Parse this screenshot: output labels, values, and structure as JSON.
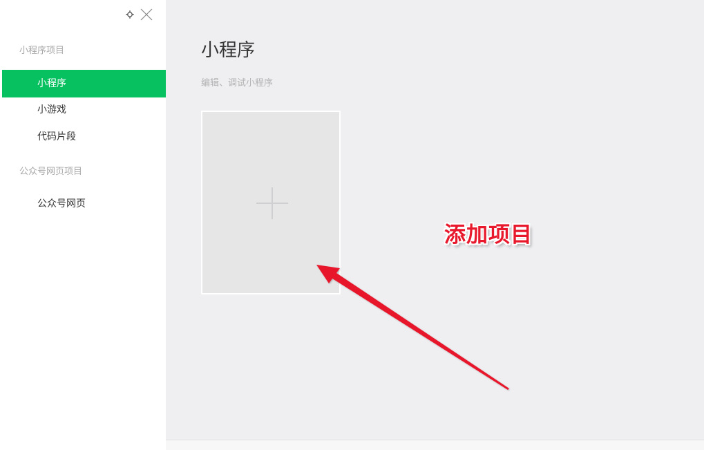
{
  "sidebar": {
    "sections": [
      {
        "title": "小程序项目",
        "items": [
          {
            "label": "小程序",
            "active": true
          },
          {
            "label": "小游戏",
            "active": false
          },
          {
            "label": "代码片段",
            "active": false
          }
        ]
      },
      {
        "title": "公众号网页项目",
        "items": [
          {
            "label": "公众号网页",
            "active": false
          }
        ]
      }
    ],
    "icons": {
      "settings": "gear-icon",
      "close": "close-icon"
    }
  },
  "main": {
    "title": "小程序",
    "subtitle": "编辑、调试小程序",
    "add_card_icon": "plus-icon"
  },
  "annotation": {
    "label": "添加项目",
    "color": "#e8192c"
  },
  "colors": {
    "accent": "#07c160",
    "background": "#efeff2",
    "sidebar": "#ffffff"
  }
}
